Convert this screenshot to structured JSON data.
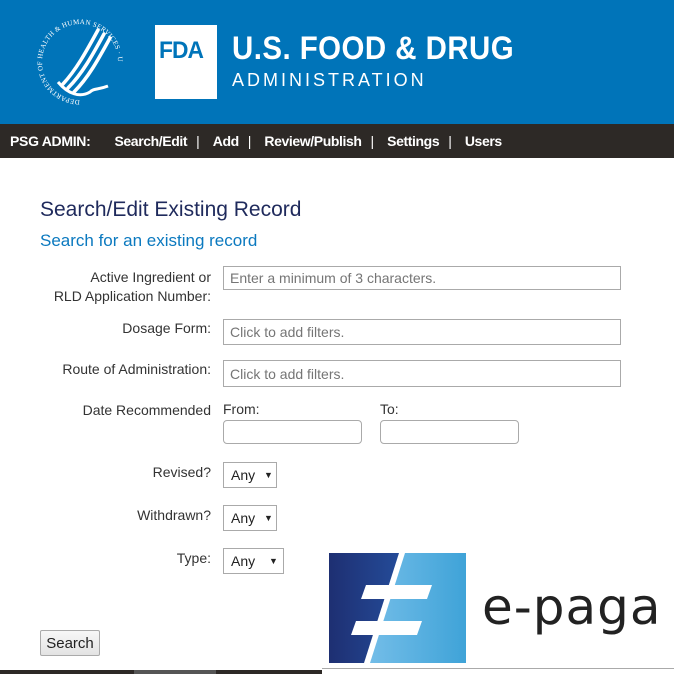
{
  "header": {
    "seal_text": "DEPARTMENT OF HEALTH & HUMAN SERVICES · USA",
    "logo_mark": "FDA",
    "brand_line1": "U.S. FOOD & DRUG",
    "brand_line2": "ADMINISTRATION",
    "brand_color": "#0074b9"
  },
  "nav": {
    "label": "PSG ADMIN:",
    "items": [
      {
        "label": "Search/Edit"
      },
      {
        "label": "Add"
      },
      {
        "label": "Review/Publish"
      },
      {
        "label": "Settings"
      },
      {
        "label": "Users"
      }
    ],
    "separator": "|"
  },
  "main": {
    "title": "Search/Edit Existing Record",
    "subtitle": "Search for an existing record",
    "fields": {
      "active_ingredient": {
        "label_line1": "Active Ingredient or",
        "label_line2": "RLD Application Number:",
        "placeholder": "Enter a minimum of 3 characters."
      },
      "dosage_form": {
        "label": "Dosage Form:",
        "placeholder": "Click to add filters."
      },
      "route": {
        "label": "Route of Administration:",
        "placeholder": "Click to add filters."
      },
      "date_recommended": {
        "label": "Date Recommended",
        "from_label": "From:",
        "to_label": "To:",
        "from_value": "",
        "to_value": ""
      },
      "revised": {
        "label": "Revised?",
        "value": "Any"
      },
      "withdrawn": {
        "label": "Withdrawn?",
        "value": "Any"
      },
      "type": {
        "label": "Type:",
        "value": "Any"
      }
    },
    "search_button": "Search"
  },
  "ad": {
    "brand": "e-paga"
  },
  "icons": {
    "dropdown_arrow": "▼"
  }
}
